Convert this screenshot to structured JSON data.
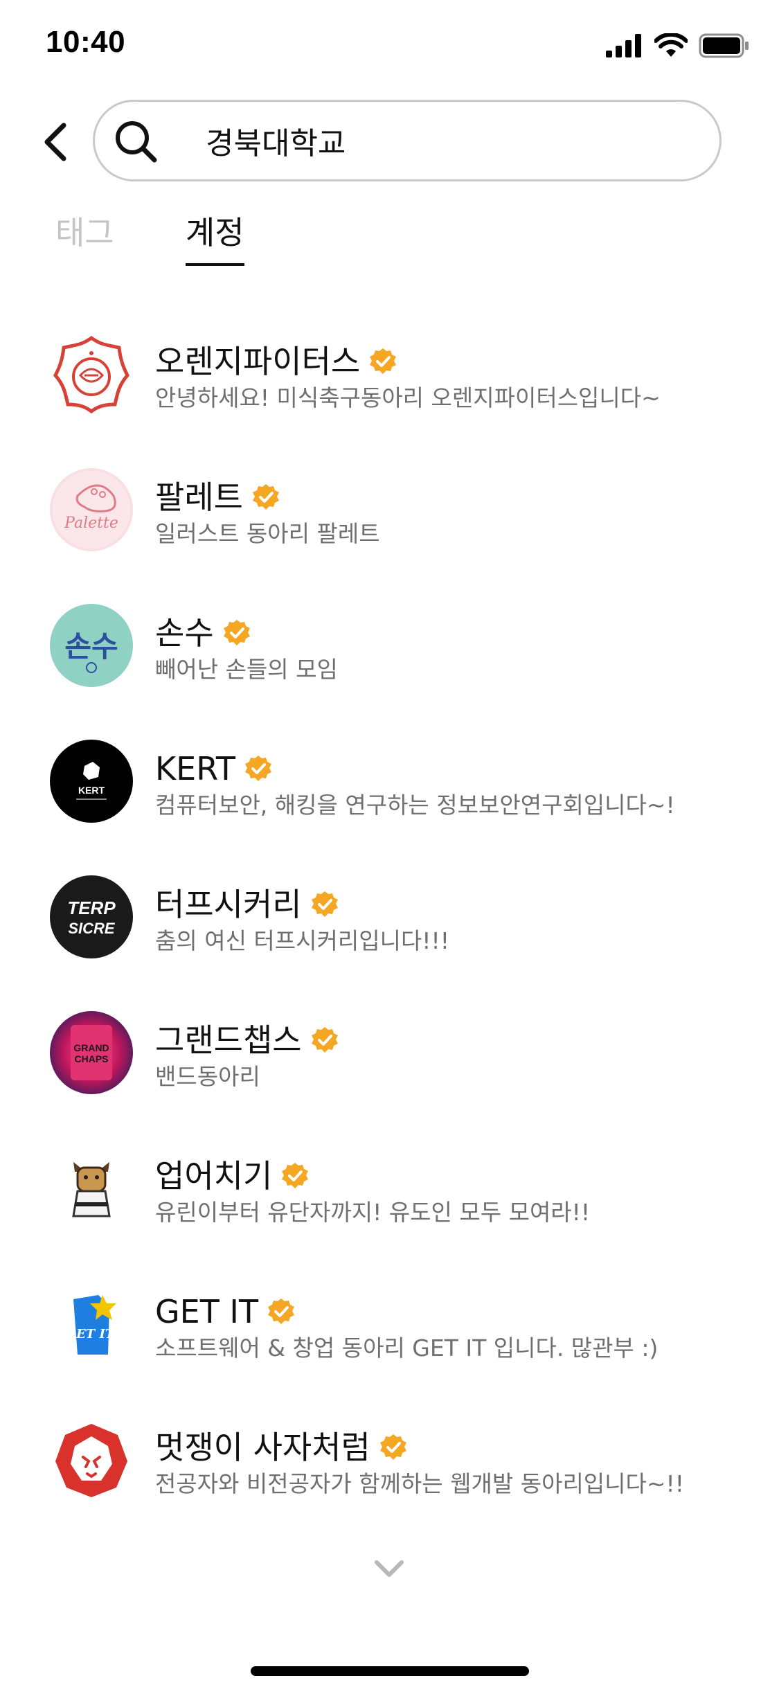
{
  "status_bar": {
    "time": "10:40",
    "icons": [
      "cellular-signal-icon",
      "wifi-icon",
      "battery-icon"
    ]
  },
  "search": {
    "query": "경북대학교",
    "back_icon": "chevron-left-icon",
    "search_icon": "magnifier-icon"
  },
  "tabs": [
    {
      "label": "태그",
      "active": false
    },
    {
      "label": "계정",
      "active": true
    }
  ],
  "accounts": [
    {
      "name": "오렌지파이터스",
      "description": "안녕하세요! 미식축구동아리 오렌지파이터스입니다~",
      "verified": true
    },
    {
      "name": "팔레트",
      "description": "일러스트 동아리 팔레트",
      "verified": true
    },
    {
      "name": "손수",
      "description": "빼어난 손들의 모임",
      "verified": true
    },
    {
      "name": "KERT",
      "description": "컴퓨터보안, 해킹을 연구하는 정보보안연구회입니다~!",
      "verified": true
    },
    {
      "name": "터프시커리",
      "description": "춤의 여신 터프시커리입니다!!!",
      "verified": true
    },
    {
      "name": "그랜드챕스",
      "description": "밴드동아리",
      "verified": true
    },
    {
      "name": "업어치기",
      "description": "유린이부터 유단자까지! 유도인 모두 모여라!!",
      "verified": true
    },
    {
      "name": "GET IT",
      "description": "소프트웨어 & 창업 동아리 GET IT 입니다. 많관부 :)",
      "verified": true
    },
    {
      "name": "멋쟁이 사자처럼",
      "description": "전공자와 비전공자가 함께하는 웹개발 동아리입니다~!!",
      "verified": true
    }
  ],
  "avatar_text": {
    "palette": "Palette",
    "sonsu": "손수",
    "kert": "KERT",
    "tersi_top": "TERP",
    "tersi_bottom": "SICRE",
    "grand": "GRAND",
    "chaps": "CHAPS",
    "getit": "GET IT"
  },
  "colors": {
    "verified_badge": "#F5A623",
    "tab_active": "#111111",
    "tab_inactive": "#C4C4C4",
    "description": "#6F6F6F",
    "search_border": "#C9C9C9"
  },
  "footer": {
    "more_icon": "chevron-down-icon"
  }
}
